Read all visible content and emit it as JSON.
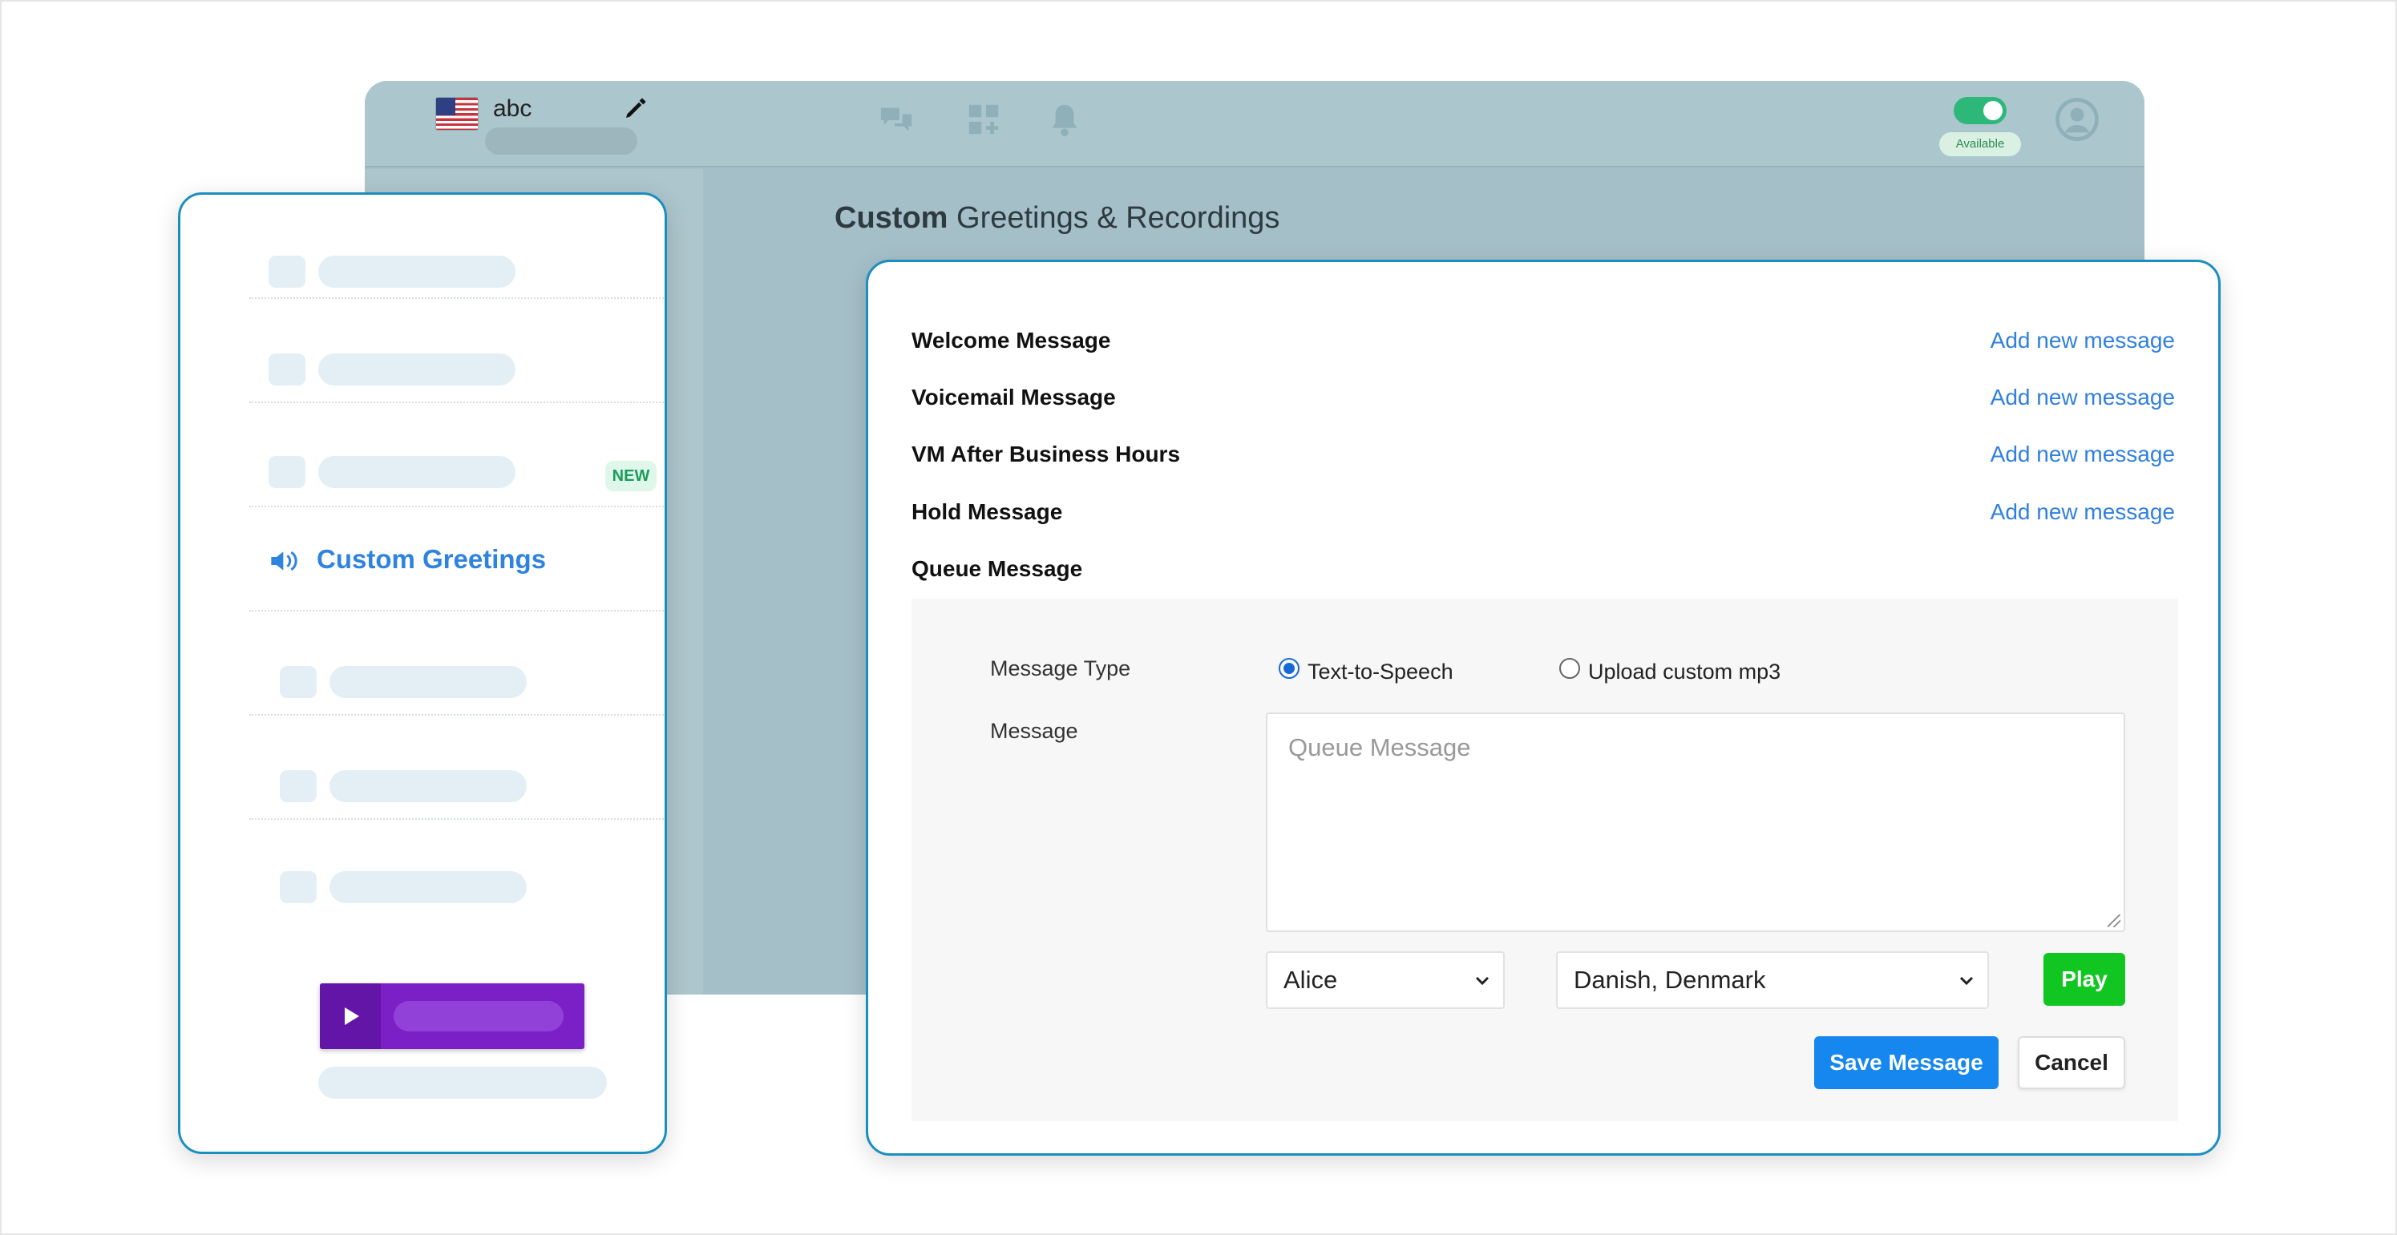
{
  "header": {
    "account_name": "abc",
    "status_label": "Available",
    "icons": [
      "flag-us-icon",
      "pencil-icon",
      "chat-icon",
      "apps-icon",
      "bell-icon",
      "status-toggle",
      "user-avatar-icon"
    ]
  },
  "page": {
    "title_bold": "Custom",
    "title_rest": " Greetings & Recordings"
  },
  "sidebar": {
    "badge_new": "NEW",
    "active_item": "Custom Greetings",
    "active_icon": "speaker-icon"
  },
  "messages": [
    {
      "label": "Welcome Message",
      "action": "Add new message"
    },
    {
      "label": "Voicemail Message",
      "action": "Add new message"
    },
    {
      "label": "VM After Business Hours",
      "action": "Add new message"
    },
    {
      "label": "Hold Message",
      "action": "Add new message"
    },
    {
      "label": "Queue Message",
      "action": ""
    }
  ],
  "editor": {
    "type_label": "Message Type",
    "option_tts": "Text-to-Speech",
    "option_mp3": "Upload custom mp3",
    "selected_option": "Text-to-Speech",
    "message_label": "Message",
    "message_placeholder": "Queue Message",
    "voice": "Alice",
    "language": "Danish, Denmark",
    "play_label": "Play",
    "save_label": "Save Message",
    "cancel_label": "Cancel"
  },
  "colors": {
    "accent_blue": "#1687ef",
    "link_blue": "#2f7fe0",
    "play_green": "#12c621",
    "card_border": "#1a8fbf",
    "player_purple": "#7b1fc6",
    "toggle_green": "#2db87a"
  }
}
